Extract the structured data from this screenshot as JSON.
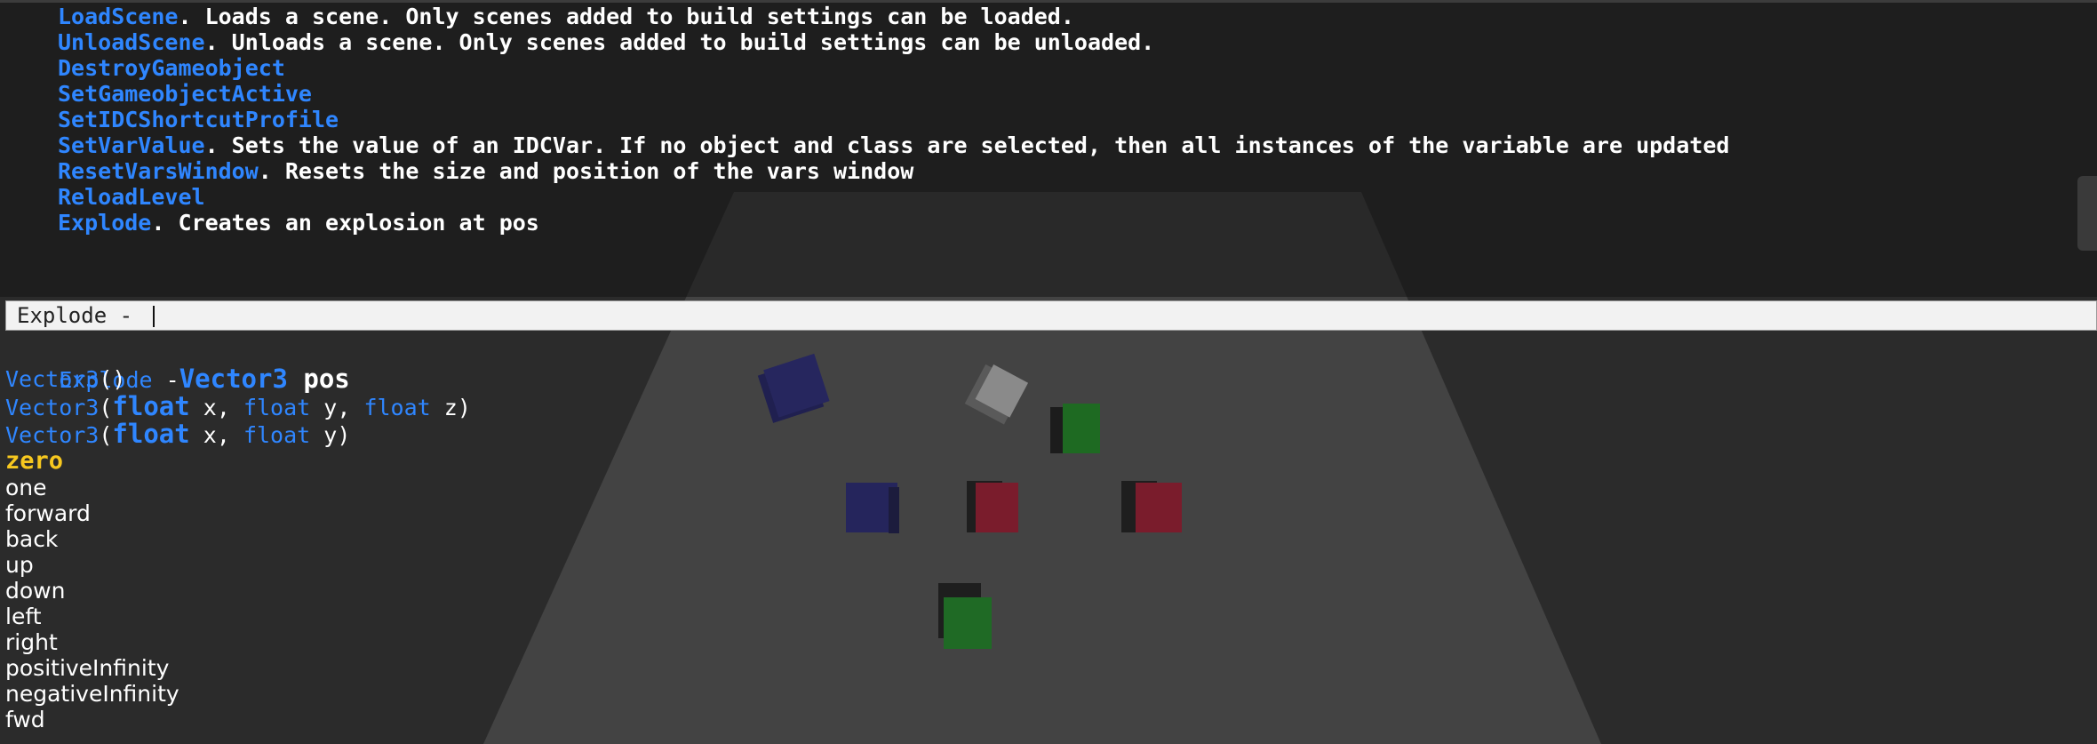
{
  "log": {
    "lines": [
      {
        "command": "LoadScene",
        "description": ". Loads a scene. Only scenes added to build settings can be loaded."
      },
      {
        "command": "UnloadScene",
        "description": ". Unloads a scene. Only scenes added to build settings can be unloaded."
      },
      {
        "command": "DestroyGameobject",
        "description": ""
      },
      {
        "command": "SetGameobjectActive",
        "description": ""
      },
      {
        "command": "SetIDCShortcutProfile",
        "description": ""
      },
      {
        "command": "SetVarValue",
        "description": ". Sets the value of an IDCVar. If no object and class are selected, then all instances of the variable are updated"
      },
      {
        "command": "ResetVarsWindow",
        "description": ". Resets the size and position of the vars window"
      },
      {
        "command": "ReloadLevel",
        "description": ""
      },
      {
        "command": "Explode",
        "description": ". Creates an explosion at pos"
      }
    ]
  },
  "console": {
    "input_value": "Explode - "
  },
  "autocomplete": {
    "signature": {
      "name": "Explode",
      "sep": " -",
      "type": "Vector3",
      "param": " pos"
    },
    "constructors": [
      {
        "name": "Vector3",
        "open": "()",
        "args": []
      },
      {
        "name": "Vector3",
        "open": "(",
        "args": [
          {
            "type": "float",
            "name": " x",
            "sep": ", "
          },
          {
            "type": "float",
            "name": " y",
            "sep": ", "
          },
          {
            "type": "float",
            "name": " z",
            "sep": ")"
          }
        ]
      },
      {
        "name": "Vector3",
        "open": "(",
        "args": [
          {
            "type": "float",
            "name": " x",
            "sep": ", "
          },
          {
            "type": "float",
            "name": " y",
            "sep": ")"
          }
        ]
      }
    ],
    "selected": "zero",
    "options": [
      "one",
      "forward",
      "back",
      "up",
      "down",
      "left",
      "right",
      "positiveInfinity",
      "negativeInfinity",
      "fwd"
    ]
  },
  "colors": {
    "command_blue": "#2f86ff",
    "selected_yellow": "#f7c81f",
    "background": "#2b2b2b",
    "floor": "#434343"
  },
  "scene": {
    "cubes": [
      "navy-cube",
      "white-cube",
      "green-cube",
      "navy-cube",
      "red-cube",
      "red-cube",
      "green-cube"
    ]
  }
}
